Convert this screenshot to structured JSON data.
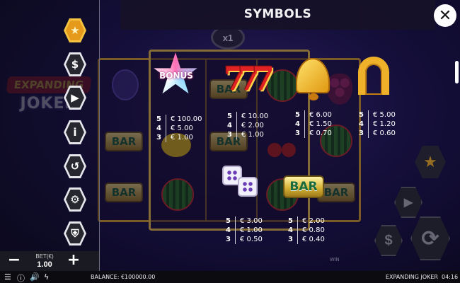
{
  "title": "SYMBOLS",
  "game_bg": {
    "multiplier": "x1",
    "logo_line1": "EXPANDING",
    "logo_line2": "JOKER",
    "bar_text": "BAR",
    "win_label": "WIN"
  },
  "menu": {
    "items": [
      {
        "name": "star",
        "glyph": "★",
        "active": true
      },
      {
        "name": "dollar",
        "glyph": "$",
        "active": false
      },
      {
        "name": "play",
        "glyph": "▶",
        "active": false
      },
      {
        "name": "info",
        "glyph": "i",
        "active": false
      },
      {
        "name": "history",
        "glyph": "↺",
        "active": false
      },
      {
        "name": "settings",
        "glyph": "⚙",
        "active": false
      },
      {
        "name": "shield",
        "glyph": "⛨",
        "active": false
      }
    ]
  },
  "bet": {
    "label": "BET(€)",
    "value": "1.00",
    "minus": "−",
    "plus": "+"
  },
  "symbols": {
    "bonus": {
      "label": "BONUS",
      "pays": [
        {
          "n": "5",
          "v": "€ 100.00"
        },
        {
          "n": "4",
          "v": "€ 5.00"
        },
        {
          "n": "3",
          "v": "€ 1.00"
        }
      ]
    },
    "sevens": {
      "label": "7",
      "pays": [
        {
          "n": "5",
          "v": "€ 10.00"
        },
        {
          "n": "4",
          "v": "€ 2.00"
        },
        {
          "n": "3",
          "v": "€ 1.00"
        }
      ]
    },
    "bell": {
      "pays": [
        {
          "n": "5",
          "v": "€ 6.00"
        },
        {
          "n": "4",
          "v": "€ 1.50"
        },
        {
          "n": "3",
          "v": "€ 0.70"
        }
      ]
    },
    "horseshoe": {
      "pays": [
        {
          "n": "5",
          "v": "€ 5.00"
        },
        {
          "n": "4",
          "v": "€ 1.20"
        },
        {
          "n": "3",
          "v": "€ 0.60"
        }
      ]
    },
    "dice": {
      "pays": [
        {
          "n": "5",
          "v": "€ 3.00"
        },
        {
          "n": "4",
          "v": "€ 1.00"
        },
        {
          "n": "3",
          "v": "€ 0.50"
        }
      ]
    },
    "bar": {
      "label": "BAR",
      "pays": [
        {
          "n": "5",
          "v": "€ 2.00"
        },
        {
          "n": "4",
          "v": "€ 0.80"
        },
        {
          "n": "3",
          "v": "€ 0.40"
        }
      ]
    }
  },
  "controls": {
    "dollar": "$",
    "play": "▶",
    "star": "★"
  },
  "status": {
    "balance": "BALANCE: €100000.00",
    "game_name": "EXPANDING JOKER",
    "clock": "04:16"
  },
  "colors": {
    "accent": "#f5c542",
    "frame": "#b8892f",
    "background": "#1d1450"
  }
}
